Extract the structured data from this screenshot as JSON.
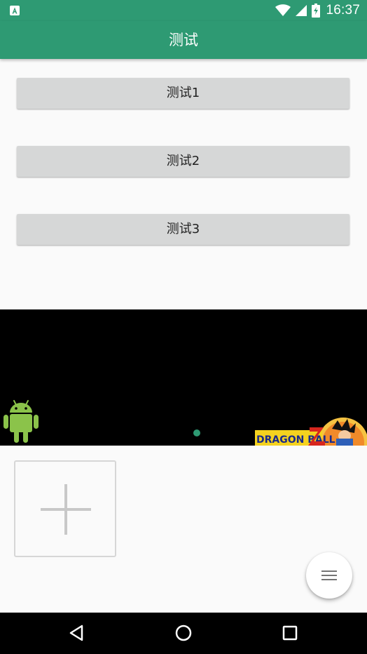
{
  "status_bar": {
    "time": "16:37",
    "left_icon": "android-system-a-icon",
    "icons": [
      "wifi-icon",
      "cellular-signal-icon",
      "battery-charging-icon"
    ]
  },
  "app_bar": {
    "title": "测试",
    "color": "#2E9A73"
  },
  "buttons": [
    {
      "label": "测试1"
    },
    {
      "label": "测试2"
    },
    {
      "label": "测试3"
    }
  ],
  "banner": {
    "images": [
      "android-logo-icon",
      "dragon-ball-z-art"
    ],
    "indicator_color": "#2E9A73"
  },
  "add_tile": {
    "icon": "plus-icon"
  },
  "fab": {
    "icon": "menu-icon"
  },
  "nav_bar": {
    "buttons": [
      "back-icon",
      "home-icon",
      "recents-icon"
    ]
  }
}
